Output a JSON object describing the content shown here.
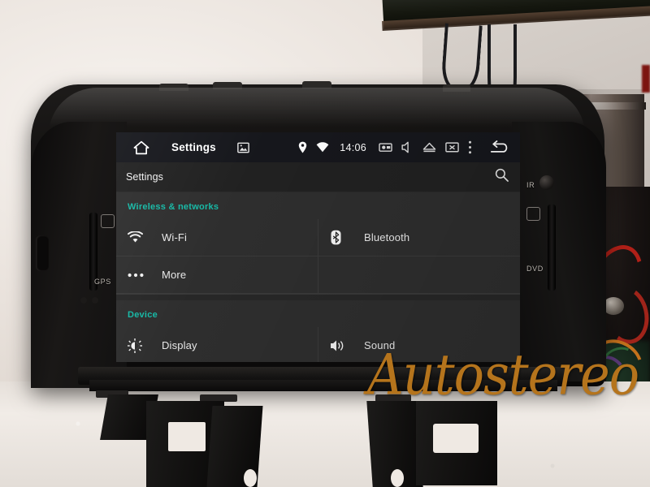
{
  "photo": {
    "watermark": "Autostereo",
    "bezel_labels": {
      "gps": "GPS",
      "ir": "IR",
      "dvd": "DVD"
    }
  },
  "screen": {
    "statusbar": {
      "home_icon": "home-icon",
      "title": "Settings",
      "gallery_icon": "gallery-icon",
      "gps_icon": "location-pin-icon",
      "wifi_icon": "wifi-icon",
      "clock": "14:06",
      "camera_icon": "camera-icon",
      "mute_icon": "volume-mute-icon",
      "eject_icon": "eject-icon",
      "screenoff_icon": "screen-off-icon",
      "overflow_icon": "overflow-menu-icon",
      "back_icon": "back-arrow-icon"
    },
    "actionbar": {
      "title": "Settings",
      "search_icon": "search-icon"
    },
    "sections": [
      {
        "header": "Wireless & networks",
        "rows": [
          [
            {
              "icon": "wifi-icon",
              "label": "Wi-Fi"
            },
            {
              "icon": "bluetooth-icon",
              "label": "Bluetooth"
            }
          ],
          [
            {
              "icon": "more-dots-icon",
              "label": "More"
            },
            {
              "icon": "",
              "label": ""
            }
          ]
        ]
      },
      {
        "header": "Device",
        "rows": [
          [
            {
              "icon": "brightness-icon",
              "label": "Display"
            },
            {
              "icon": "sound-icon",
              "label": "Sound"
            }
          ]
        ]
      }
    ]
  },
  "colors": {
    "accent_teal": "#16b9a6",
    "statusbar_bg": "#16171c",
    "actionbar_bg": "#212121",
    "list_bg": "#2e2e2e",
    "watermark_gold": "#b5741c"
  }
}
